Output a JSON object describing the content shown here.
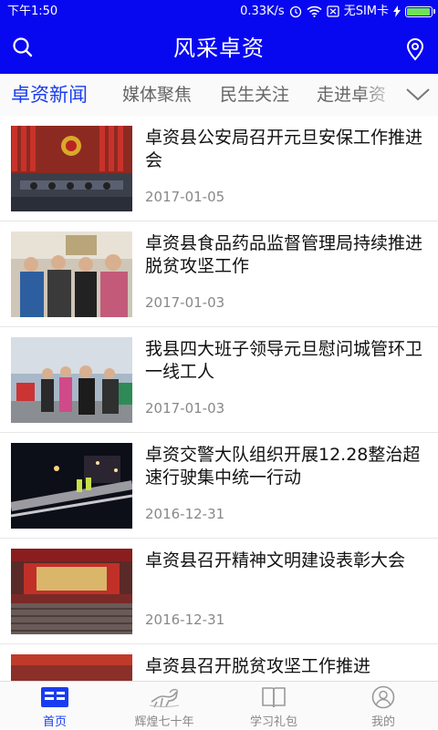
{
  "status_bar": {
    "time": "下午1:50",
    "speed": "0.33K/s",
    "sim": "无SIM卡",
    "battery_level": 0.95
  },
  "header": {
    "title": "风采卓资",
    "search_icon": "search-icon",
    "location_icon": "location-pin-icon"
  },
  "tabs": [
    {
      "label": "卓资新闻",
      "active": true
    },
    {
      "label": "媒体聚焦",
      "active": false
    },
    {
      "label": "民生关注",
      "active": false
    },
    {
      "label": "走进卓资",
      "active": false
    }
  ],
  "tabs_more_icon": "chevron-down-icon",
  "news": [
    {
      "title": "卓资县公安局召开元旦安保工作推进会",
      "date": "2017-01-05"
    },
    {
      "title": "卓资县食品药品监督管理局持续推进脱贫攻坚工作",
      "date": "2017-01-03"
    },
    {
      "title": "我县四大班子领导元旦慰问城管环卫一线工人",
      "date": "2017-01-03"
    },
    {
      "title": "卓资交警大队组织开展12.28整治超速行驶集中统一行动",
      "date": "2016-12-31"
    },
    {
      "title": "卓资县召开精神文明建设表彰大会",
      "date": "2016-12-31"
    },
    {
      "title": "卓资县召开脱贫攻坚工作推进",
      "date": ""
    }
  ],
  "bottom_nav": [
    {
      "label": "首页",
      "icon": "news-home-icon",
      "active": true
    },
    {
      "label": "辉煌七十年",
      "icon": "horse-icon",
      "active": false
    },
    {
      "label": "学习礼包",
      "icon": "open-book-icon",
      "active": false
    },
    {
      "label": "我的",
      "icon": "user-icon",
      "active": false
    }
  ],
  "colors": {
    "brand_blue": "#0808f0",
    "tab_active": "#1a3cf0"
  }
}
